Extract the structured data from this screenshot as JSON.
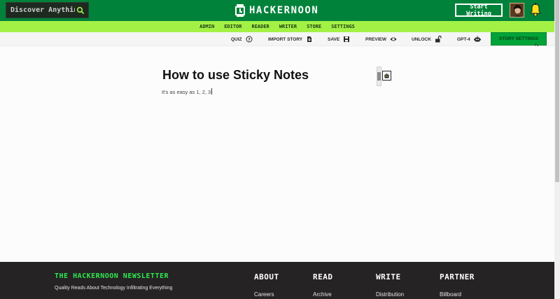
{
  "header": {
    "search_placeholder": "Discover Anything",
    "logo_text": "HACKERNOON",
    "start_writing": "Start Writing"
  },
  "nav": [
    "ADMIN",
    "EDITOR",
    "READER",
    "WRITER",
    "STORE",
    "SETTINGS"
  ],
  "toolbar": {
    "quiz": "QUIZ",
    "import_story": "IMPORT STORY",
    "save": "SAVE",
    "preview": "PREVIEW",
    "unlock": "UNLOCK",
    "gpt4": "GPT-4",
    "story_settings": "STORY SETTINGS"
  },
  "editor": {
    "title": "How to use Sticky Notes",
    "body": "It's as easy as 1, 2, 3"
  },
  "footer": {
    "newsletter_heading": "THE HACKERNOON NEWSLETTER",
    "tagline": "Quality Reads About Technology Infiltrating Everything",
    "columns": [
      {
        "heading": "ABOUT",
        "link": "Careers"
      },
      {
        "heading": "READ",
        "link": "Archive"
      },
      {
        "heading": "WRITE",
        "link": "Distribution"
      },
      {
        "heading": "PARTNER",
        "link": "Billboard"
      }
    ]
  },
  "colors": {
    "header_green": "#00823a",
    "nav_lime": "#a4f146",
    "accent_green": "#00a338",
    "footer_dark": "#252324",
    "newsletter_green": "#2ee84e"
  },
  "icons": [
    "search-icon",
    "logo-icon",
    "bell-icon",
    "quiz-icon",
    "import-icon",
    "save-icon",
    "eye-icon",
    "unlock-icon",
    "robot-icon",
    "cursor-icon"
  ]
}
